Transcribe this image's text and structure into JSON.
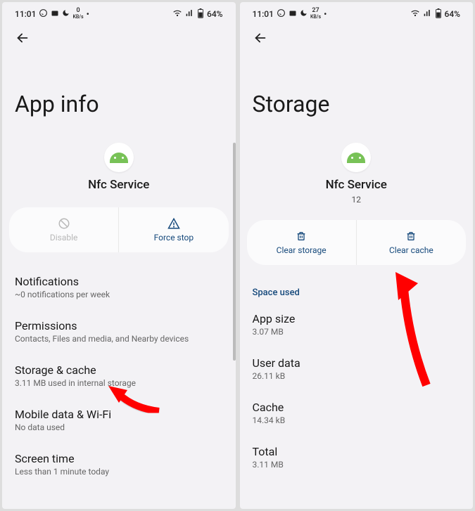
{
  "statusBar": {
    "time": "11:01",
    "kbs": "0",
    "kbs2": "27",
    "kbsUnit": "KB/s",
    "battery": "64%"
  },
  "screen1": {
    "title": "App info",
    "appName": "Nfc Service",
    "buttons": {
      "disable": "Disable",
      "forceStop": "Force stop"
    },
    "items": [
      {
        "primary": "Notifications",
        "secondary": "~0 notifications per week"
      },
      {
        "primary": "Permissions",
        "secondary": "Contacts, Files and media, and Nearby devices"
      },
      {
        "primary": "Storage & cache",
        "secondary": "3.11 MB used in internal storage"
      },
      {
        "primary": "Mobile data & Wi-Fi",
        "secondary": "No data used"
      },
      {
        "primary": "Screen time",
        "secondary": "Less than 1 minute today"
      }
    ]
  },
  "screen2": {
    "title": "Storage",
    "appName": "Nfc Service",
    "version": "12",
    "buttons": {
      "clearStorage": "Clear storage",
      "clearCache": "Clear cache"
    },
    "section": "Space used",
    "items": [
      {
        "primary": "App size",
        "secondary": "3.07 MB"
      },
      {
        "primary": "User data",
        "secondary": "26.11 kB"
      },
      {
        "primary": "Cache",
        "secondary": "14.34 kB"
      },
      {
        "primary": "Total",
        "secondary": "3.11 MB"
      }
    ]
  }
}
